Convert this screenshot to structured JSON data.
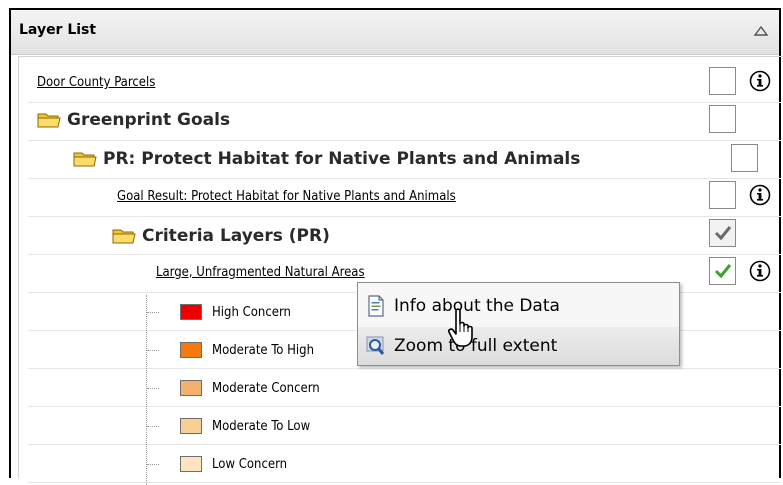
{
  "header": {
    "title": "Layer List"
  },
  "layers": {
    "door_county": {
      "label": "Door County Parcels"
    },
    "greenprint": {
      "label": "Greenprint Goals"
    },
    "protect": {
      "label": "PR: Protect Habitat for Native Plants and Animals"
    },
    "goal_result": {
      "label": "Goal Result: Protect Habitat for Native Plants and Animals"
    },
    "criteria": {
      "label": "Criteria Layers (PR)"
    },
    "large_areas": {
      "label": "Large, Unfragmented Natural Areas"
    }
  },
  "legend": [
    {
      "label": "High Concern",
      "color": "#ee0000"
    },
    {
      "label": "Moderate To High",
      "color": "#f47a10"
    },
    {
      "label": "Moderate Concern",
      "color": "#f2b26e"
    },
    {
      "label": "Moderate To Low",
      "color": "#f7d095"
    },
    {
      "label": "Low Concern",
      "color": "#fde5c2"
    }
  ],
  "context_menu": {
    "info": "Info about the Data",
    "zoom": "Zoom to full extent"
  },
  "colors": {
    "check_green": "#3aa32a",
    "check_gray": "#6a6a6a",
    "folder": "#f3c333"
  }
}
